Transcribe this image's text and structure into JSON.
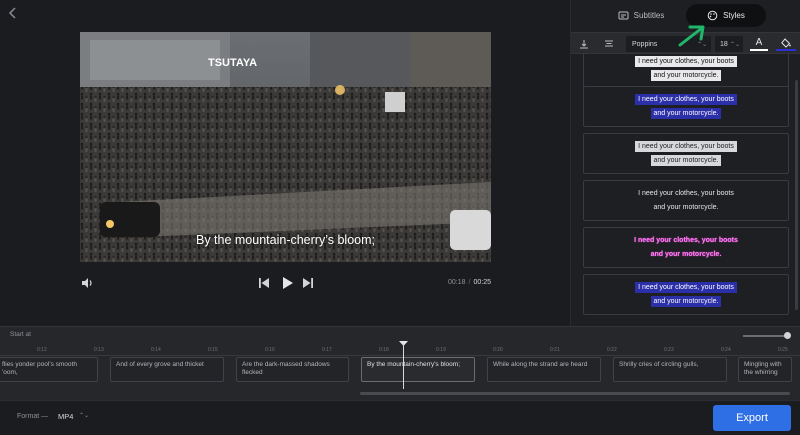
{
  "header": {
    "back_icon": "chevron-left-icon"
  },
  "video": {
    "caption": "By the mountain-cherry’s bloom;",
    "sign_text": "TSUTAYA"
  },
  "player": {
    "current_time": "00:18",
    "separator": "/",
    "total_time": "00:25"
  },
  "panel": {
    "tabs": [
      {
        "label": "Subtitles",
        "icon": "subtitles-icon",
        "active": false
      },
      {
        "label": "Styles",
        "icon": "palette-icon",
        "active": true
      }
    ],
    "toolbar": {
      "font": "Poppins",
      "font_size": "18",
      "text_color_label": "A",
      "text_color": "#ffffff",
      "fill_color": "#2b2fd4"
    },
    "style_presets": [
      {
        "line1": "I need your clothes, your boots",
        "line2": "and your motorcycle."
      },
      {
        "line1": "I need your clothes, your boots",
        "line2": "and your motorcycle."
      },
      {
        "line1": "I need your clothes, your boots",
        "line2": "and your motorcycle."
      },
      {
        "line1": "I need your clothes, your boots",
        "line2": "and your motorcycle."
      },
      {
        "line1": "I need your clothes, your boots",
        "line2": "and your motorcycle."
      },
      {
        "line1": "I need your clothes, your boots",
        "line2": "and your motorcycle."
      }
    ]
  },
  "timeline": {
    "start_at": "Start at",
    "ticks": [
      "0:12",
      "0:13",
      "0:14",
      "0:15",
      "0:16",
      "0:17",
      "0:18",
      "0:19",
      "0:20",
      "0:21",
      "0:22",
      "0:23",
      "0:24",
      "0:25"
    ],
    "segments": [
      {
        "text": "flies yonder pool's smooth 'oom,"
      },
      {
        "text": "And of every grove and thicket"
      },
      {
        "text": "Are the dark-massed shadows flecked"
      },
      {
        "text": "By the mountain-cherry's bloom;"
      },
      {
        "text": "While along the strand are heard"
      },
      {
        "text": "Shrilly cries of circling gulls,"
      },
      {
        "text": "Mingling with the whirring"
      }
    ]
  },
  "footer": {
    "format_label": "Format —",
    "format_value": "MP4",
    "export_label": "Export",
    "accent": "#2f6fe6"
  }
}
